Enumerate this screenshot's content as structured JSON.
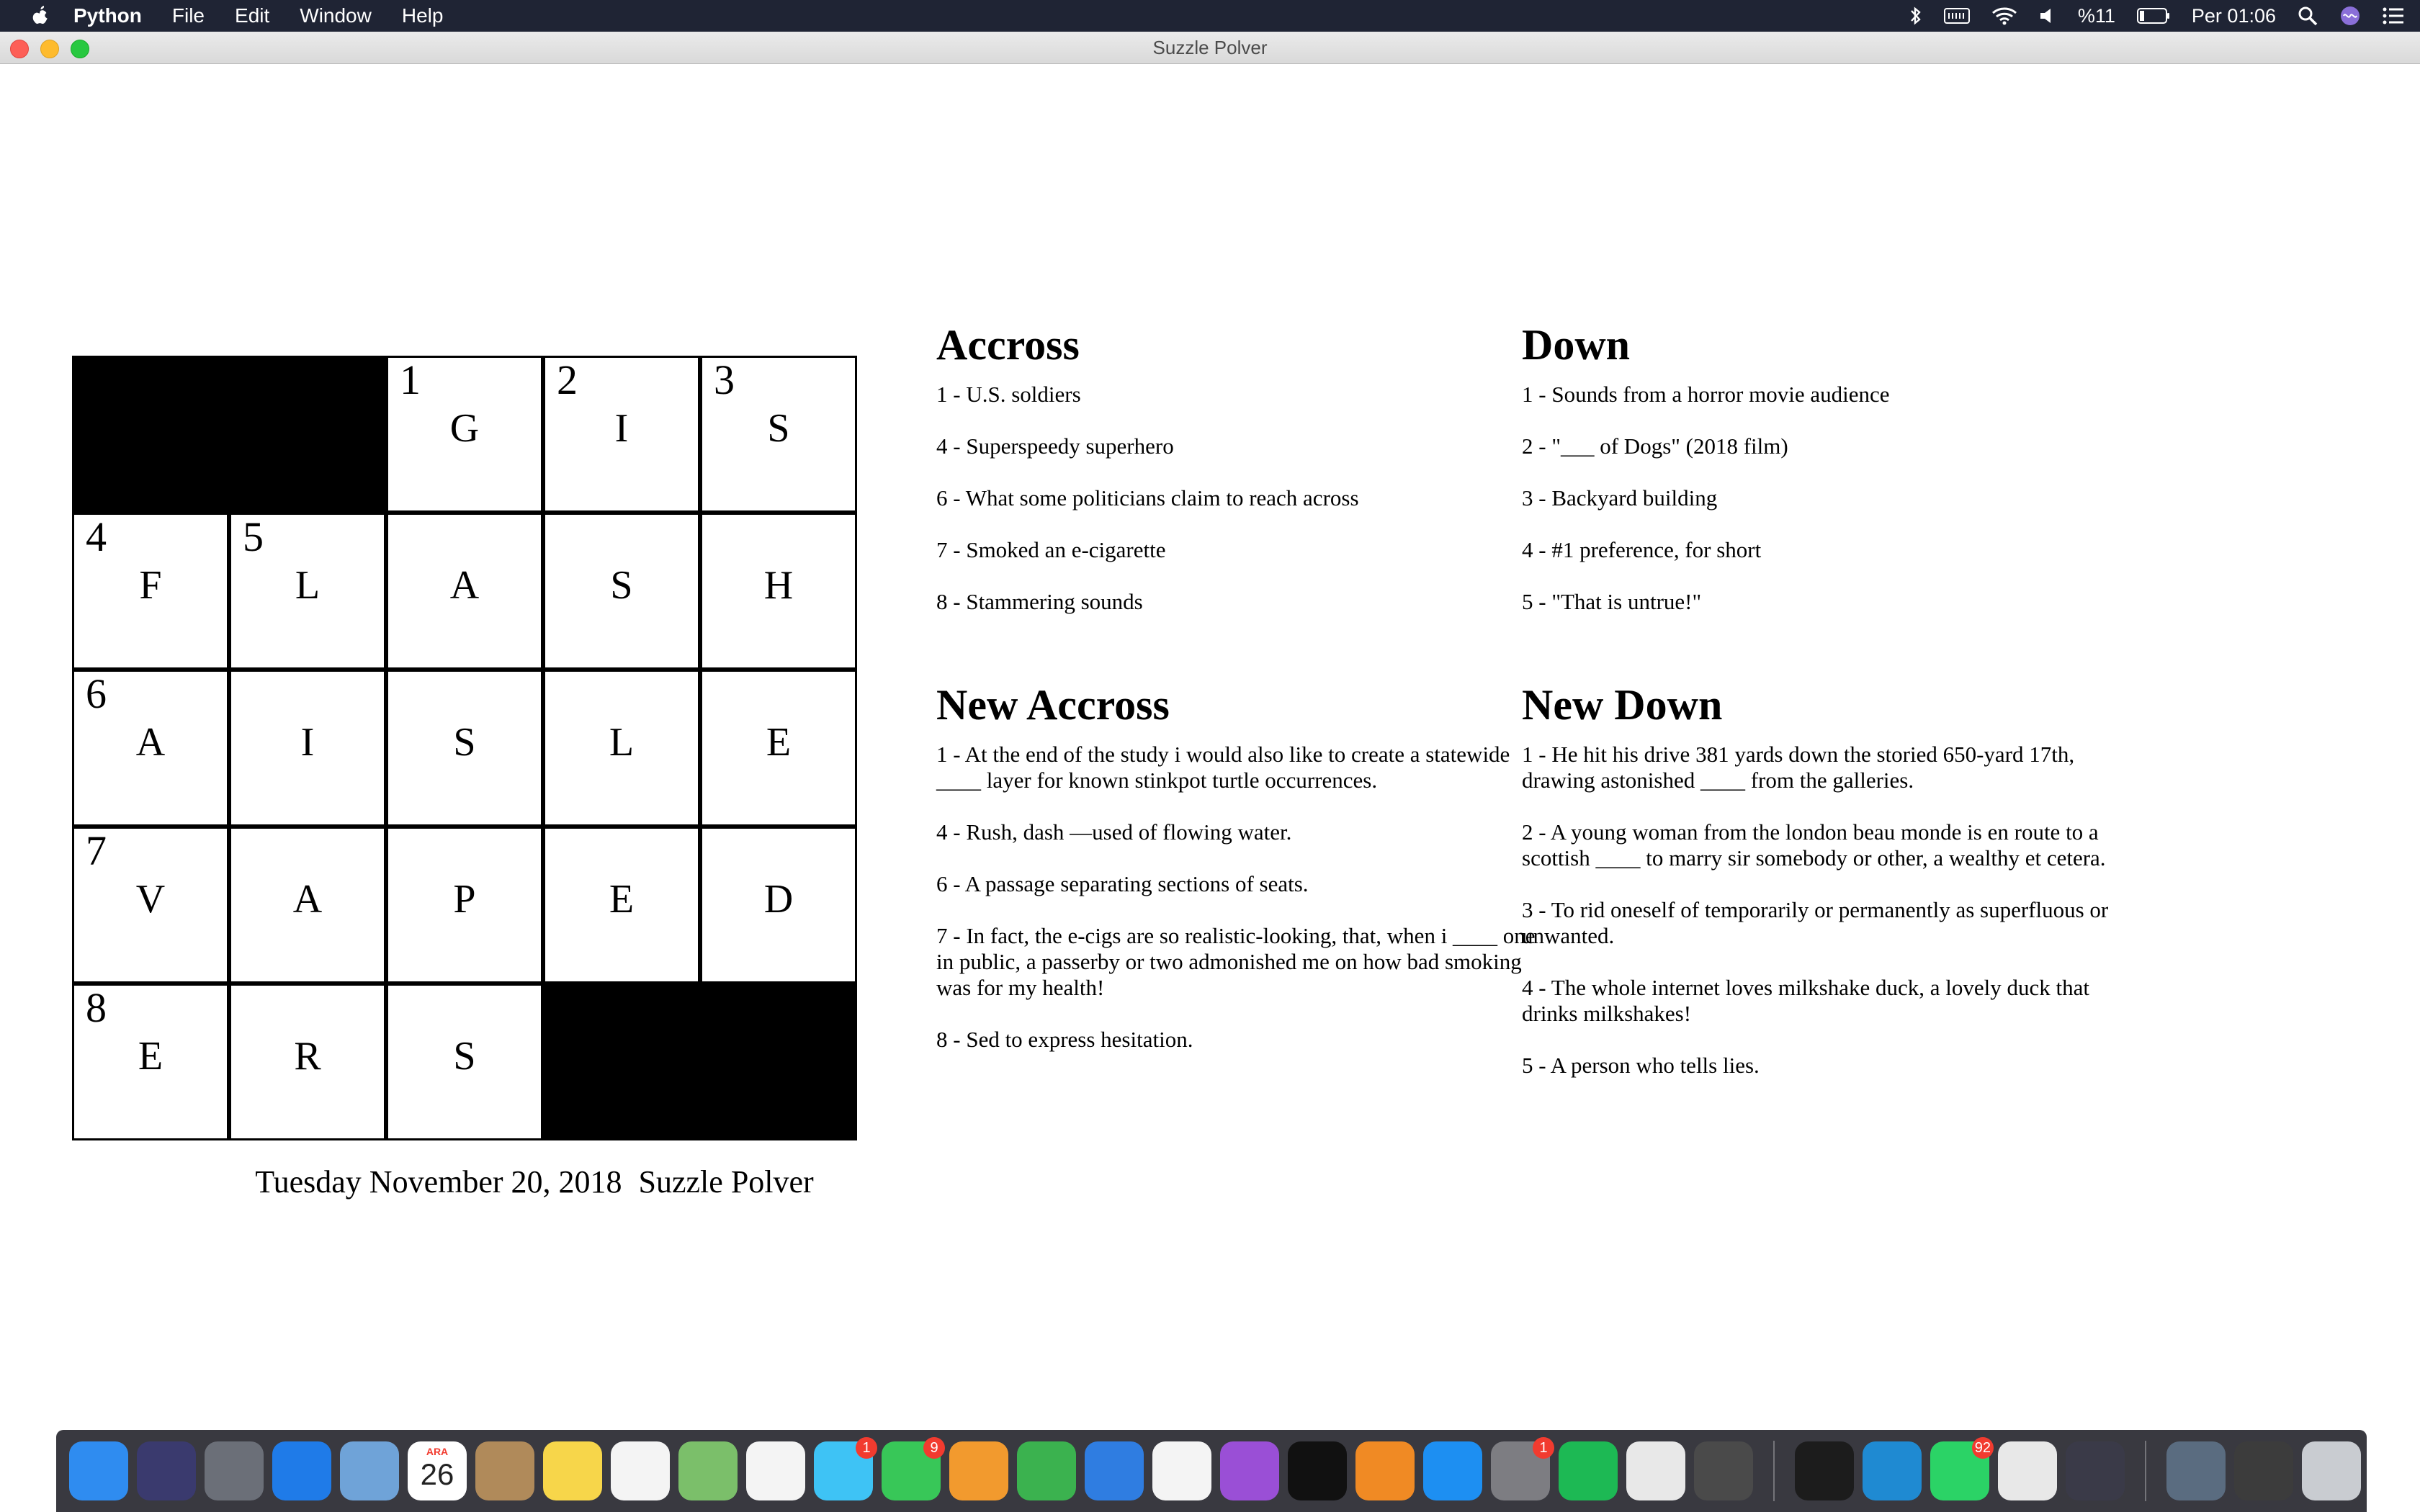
{
  "menubar": {
    "app_name": "Python",
    "items": [
      "File",
      "Edit",
      "Window",
      "Help"
    ],
    "battery_text": "%11",
    "clock": "Per 01:06"
  },
  "window": {
    "title": "Suzzle Polver"
  },
  "grid": {
    "cells": [
      {
        "r": 0,
        "c": 0,
        "black": true
      },
      {
        "r": 0,
        "c": 1,
        "black": true
      },
      {
        "r": 0,
        "c": 2,
        "num": "1",
        "letter": "G"
      },
      {
        "r": 0,
        "c": 3,
        "num": "2",
        "letter": "I"
      },
      {
        "r": 0,
        "c": 4,
        "num": "3",
        "letter": "S"
      },
      {
        "r": 1,
        "c": 0,
        "num": "4",
        "letter": "F"
      },
      {
        "r": 1,
        "c": 1,
        "num": "5",
        "letter": "L"
      },
      {
        "r": 1,
        "c": 2,
        "letter": "A"
      },
      {
        "r": 1,
        "c": 3,
        "letter": "S"
      },
      {
        "r": 1,
        "c": 4,
        "letter": "H"
      },
      {
        "r": 2,
        "c": 0,
        "num": "6",
        "letter": "A"
      },
      {
        "r": 2,
        "c": 1,
        "letter": "I"
      },
      {
        "r": 2,
        "c": 2,
        "letter": "S"
      },
      {
        "r": 2,
        "c": 3,
        "letter": "L"
      },
      {
        "r": 2,
        "c": 4,
        "letter": "E"
      },
      {
        "r": 3,
        "c": 0,
        "num": "7",
        "letter": "V"
      },
      {
        "r": 3,
        "c": 1,
        "letter": "A"
      },
      {
        "r": 3,
        "c": 2,
        "letter": "P"
      },
      {
        "r": 3,
        "c": 3,
        "letter": "E"
      },
      {
        "r": 3,
        "c": 4,
        "letter": "D"
      },
      {
        "r": 4,
        "c": 0,
        "num": "8",
        "letter": "E"
      },
      {
        "r": 4,
        "c": 1,
        "letter": "R"
      },
      {
        "r": 4,
        "c": 2,
        "letter": "S"
      },
      {
        "r": 4,
        "c": 3,
        "black": true
      },
      {
        "r": 4,
        "c": 4,
        "black": true
      }
    ]
  },
  "footer": {
    "date": "Tuesday November 20, 2018",
    "name": "Suzzle Polver"
  },
  "across": {
    "title": "Accross",
    "clues": [
      "1 - U.S. soldiers",
      "4 - Superspeedy superhero",
      "6 - What some politicians claim to reach across",
      "7 - Smoked an e-cigarette",
      "8 - Stammering sounds"
    ]
  },
  "down": {
    "title": "Down",
    "clues": [
      "1 - Sounds from a horror movie audience",
      "2 - \"___ of Dogs\" (2018 film)",
      "3 - Backyard building",
      "4 - #1 preference, for short",
      "5 - \"That is untrue!\""
    ]
  },
  "new_across": {
    "title": "New Accross",
    "clues": [
      "1 - At the end of the study i would also like to create a statewide ____ layer for known stinkpot turtle occurrences.",
      "4 - Rush, dash —used of flowing water.",
      "6 - A passage separating sections of seats.",
      "7 - In fact, the e-cigs are so realistic-looking, that, when i ____ one in public, a passerby or two admonished me on how bad smoking was for my health!",
      "8 - Sed to express hesitation."
    ]
  },
  "new_down": {
    "title": "New Down",
    "clues": [
      "1 - He hit his drive 381 yards down the storied 650-yard 17th, drawing astonished ____ from the galleries.",
      "2 - A young woman from the london beau monde is en route to a scottish ____ to marry sir somebody or other, a wealthy et cetera.",
      "3 - To rid oneself of temporarily or permanently as superfluous or unwanted.",
      "4 - The whole internet loves milkshake duck, a lovely duck that drinks milkshakes!",
      "5 - A person who tells lies."
    ]
  },
  "dock": {
    "calendar": {
      "month": "ARA",
      "day": "26"
    },
    "badges": {
      "messages": "1",
      "facetime": "9",
      "system_preferences": "1",
      "whatsapp": "92"
    },
    "apps": [
      {
        "name": "finder-icon",
        "color": "#2f8cf0"
      },
      {
        "name": "siri-icon",
        "color": "#3a3a6e"
      },
      {
        "name": "launchpad-icon",
        "color": "#6b6f78"
      },
      {
        "name": "safari-icon",
        "color": "#1f7be8"
      },
      {
        "name": "mail-icon",
        "color": "#6fa3d8"
      },
      {
        "name": "calendar-icon",
        "color": "#ffffff"
      },
      {
        "name": "contacts-icon",
        "color": "#b08a5a"
      },
      {
        "name": "notes-icon",
        "color": "#f7d64a"
      },
      {
        "name": "reminders-icon",
        "color": "#f4f4f4"
      },
      {
        "name": "maps-icon",
        "color": "#7bbf6a"
      },
      {
        "name": "photos-icon",
        "color": "#f4f4f4"
      },
      {
        "name": "messages-icon",
        "color": "#3ec3f5"
      },
      {
        "name": "facetime-icon",
        "color": "#38c758"
      },
      {
        "name": "pages-icon",
        "color": "#f29a2e"
      },
      {
        "name": "numbers-icon",
        "color": "#3bb24f"
      },
      {
        "name": "keynote-icon",
        "color": "#2f7de1"
      },
      {
        "name": "music-icon",
        "color": "#f4f4f4"
      },
      {
        "name": "podcasts-icon",
        "color": "#9a4fd6"
      },
      {
        "name": "apple-tv-icon",
        "color": "#111111"
      },
      {
        "name": "books-icon",
        "color": "#f08a24"
      },
      {
        "name": "app-store-icon",
        "color": "#1d8ff2"
      },
      {
        "name": "system-preferences-icon",
        "color": "#7d7d82"
      },
      {
        "name": "spotify-icon",
        "color": "#1db954"
      },
      {
        "name": "chrome-icon",
        "color": "#e8e8e8"
      },
      {
        "name": "sublime-text-icon",
        "color": "#4a4a4a"
      },
      {
        "name": "terminal-icon",
        "color": "#1c1c1c"
      },
      {
        "name": "vscode-icon",
        "color": "#1f8ad2"
      },
      {
        "name": "whatsapp-icon",
        "color": "#2bd366"
      },
      {
        "name": "chrome-2-icon",
        "color": "#e8e8e8"
      },
      {
        "name": "rocket-icon",
        "color": "#3a3a48"
      },
      {
        "name": "folder-icon",
        "color": "#5a6c80"
      },
      {
        "name": "window-thumbnail-icon",
        "color": "#3c3c3c"
      },
      {
        "name": "trash-icon",
        "color": "#c9ccd1"
      }
    ]
  }
}
